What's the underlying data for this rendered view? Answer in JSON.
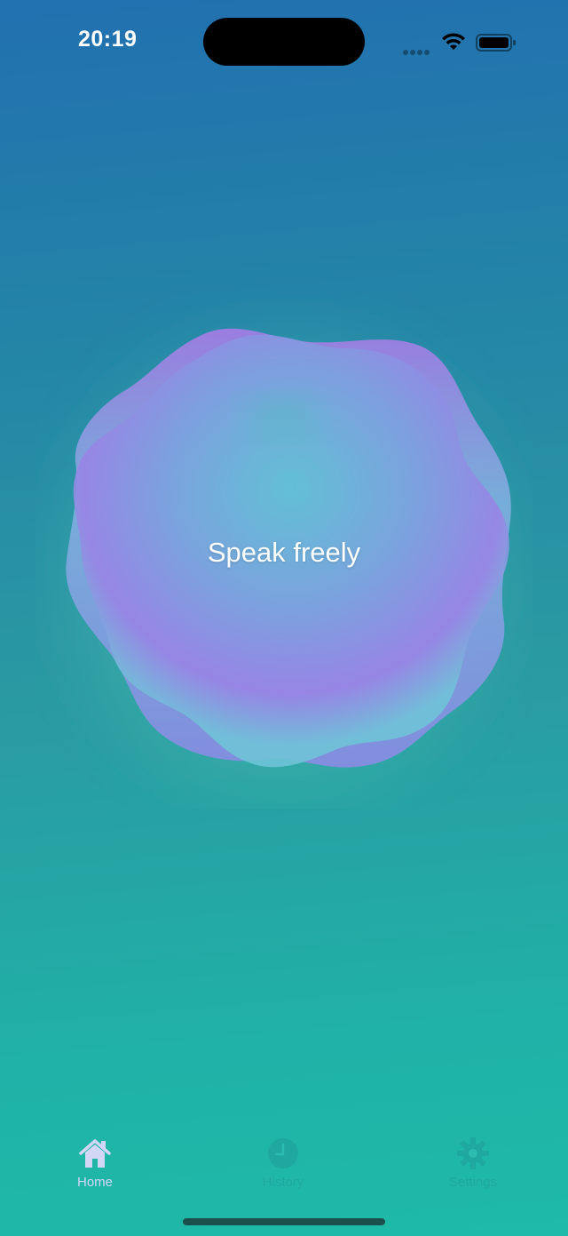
{
  "status_bar": {
    "time": "20:19"
  },
  "main": {
    "prompt_text": "Speak freely"
  },
  "tab_bar": {
    "tabs": [
      {
        "label": "Home",
        "icon": "house-icon",
        "active": true
      },
      {
        "label": "History",
        "icon": "clock-icon",
        "active": false
      },
      {
        "label": "Settings",
        "icon": "gear-icon",
        "active": false
      }
    ]
  },
  "colors": {
    "background_top": "#2170b0",
    "background_bottom": "#1fbaa8",
    "blob_purple": "#9a7ae6",
    "blob_teal": "#5fbad6",
    "active_tab": "#d4d6f6",
    "inactive_tab": "#1fa89f"
  }
}
